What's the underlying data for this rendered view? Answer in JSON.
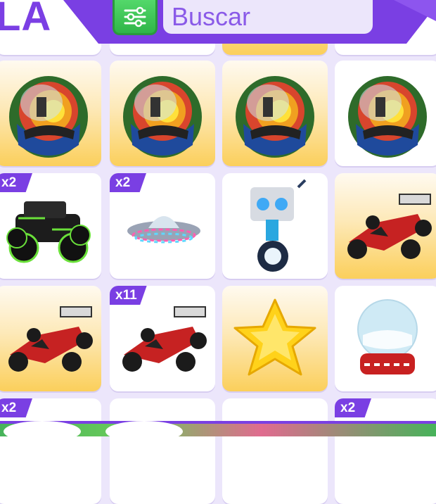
{
  "header": {
    "title_fragment": "LA",
    "search": {
      "placeholder": "Buscar"
    },
    "filter_icon": "sliders-icon"
  },
  "inventory": {
    "row0_partial": [
      {
        "item": "partial-item",
        "bg": "white"
      },
      {
        "item": "partial-item",
        "bg": "white"
      },
      {
        "item": "partial-item",
        "bg": "gold"
      },
      {
        "item": "partial-item",
        "bg": "white"
      }
    ],
    "rows": [
      [
        {
          "item": "glass-egg",
          "bg": "gold",
          "badge": ""
        },
        {
          "item": "glass-egg",
          "bg": "gold",
          "badge": ""
        },
        {
          "item": "glass-egg",
          "bg": "gold",
          "badge": ""
        },
        {
          "item": "glass-egg",
          "bg": "white",
          "badge": ""
        }
      ],
      [
        {
          "item": "monster-truck",
          "bg": "white",
          "badge": "x2"
        },
        {
          "item": "ufo",
          "bg": "white",
          "badge": "x2"
        },
        {
          "item": "robot-unicycle",
          "bg": "white",
          "badge": ""
        },
        {
          "item": "race-car",
          "bg": "gold",
          "badge": ""
        }
      ],
      [
        {
          "item": "race-car",
          "bg": "gold",
          "badge": ""
        },
        {
          "item": "race-car",
          "bg": "white",
          "badge": "x11"
        },
        {
          "item": "star-pillow",
          "bg": "gold",
          "badge": ""
        },
        {
          "item": "snow-globe",
          "bg": "white",
          "badge": ""
        }
      ]
    ],
    "bottom_partial_badges": [
      "x2",
      "",
      "",
      "x2"
    ]
  },
  "colors": {
    "purple": "#7a3fe3",
    "gold": "#fbcf5b",
    "green": "#3fc457",
    "panel": "#ece6fb"
  }
}
